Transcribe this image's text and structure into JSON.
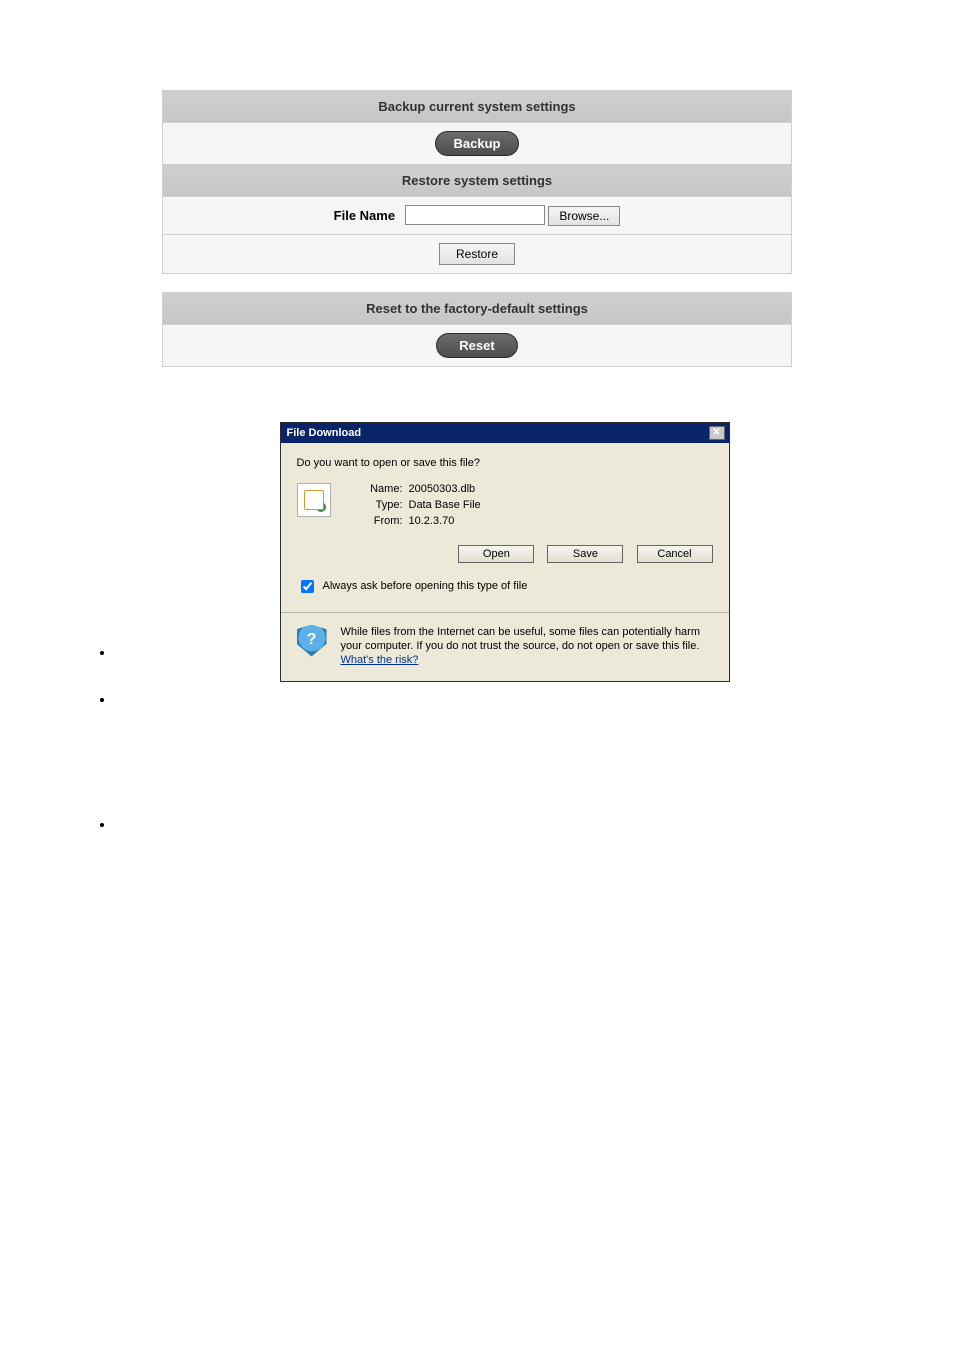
{
  "config": {
    "backup_header": "Backup current system settings",
    "backup_btn": "Backup",
    "restore_header": "Restore system settings",
    "file_name_label": "File Name",
    "file_name_value": "",
    "browse_btn": "Browse...",
    "restore_btn": "Restore",
    "reset_header": "Reset to the factory-default settings",
    "reset_btn": "Reset"
  },
  "dialog": {
    "title": "File Download",
    "close_glyph": "✕",
    "prompt": "Do you want to open or save this file?",
    "name_label": "Name:",
    "name_value": "20050303.dlb",
    "type_label": "Type:",
    "type_value": "Data Base File",
    "from_label": "From:",
    "from_value": "10.2.3.70",
    "open_btn": "Open",
    "save_btn": "Save",
    "cancel_btn": "Cancel",
    "always_ask": "Always ask before opening this type of file",
    "warning": "While files from the Internet can be useful, some files can potentially harm your computer. If you do not trust the source, do not open or save this file. ",
    "risk_link": "What's the risk?"
  }
}
